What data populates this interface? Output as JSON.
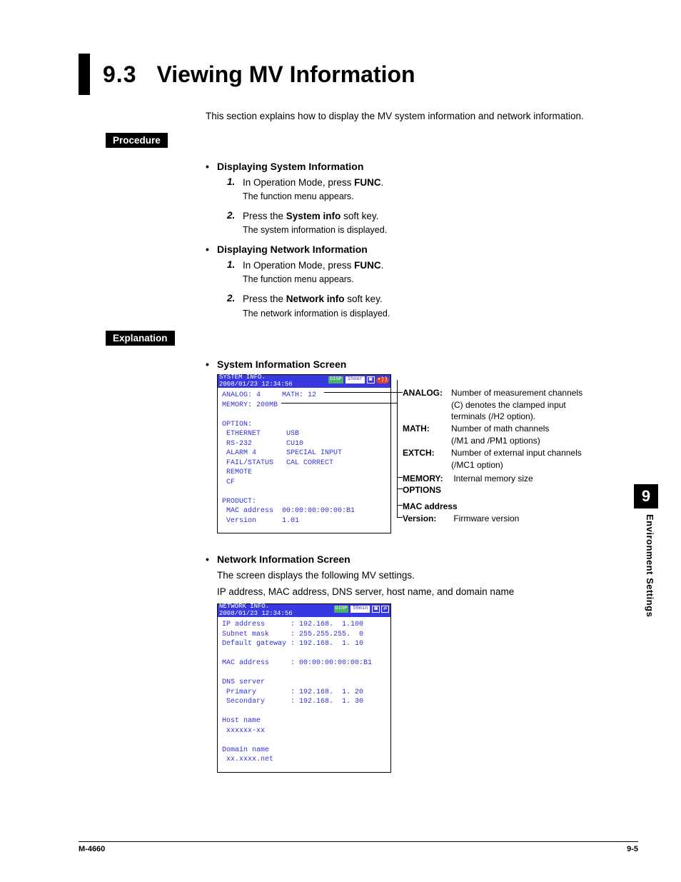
{
  "header": {
    "section_number": "9.3",
    "section_title": "Viewing MV Information",
    "intro": "This section explains how to display the MV system information and network information."
  },
  "labels": {
    "procedure": "Procedure",
    "explanation": "Explanation"
  },
  "procedure": {
    "sys_heading": "Displaying System Information",
    "net_heading": "Displaying Network Information",
    "step1_pre": "In Operation Mode, press ",
    "step1_key": "FUNC",
    "step1_post": ".",
    "step1_note": "The function menu appears.",
    "sys_step2_pre": "Press the ",
    "sys_step2_key": "System info",
    "sys_step2_post": " soft key.",
    "sys_step2_note": "The system information is displayed.",
    "net_step2_pre": "Press the ",
    "net_step2_key": "Network info",
    "net_step2_post": " soft key.",
    "net_step2_note": "The network information is displayed.",
    "num1": "1.",
    "num2": "2."
  },
  "explanation": {
    "sys_screen_heading": "System Information Screen",
    "net_screen_heading": "Network Information Screen",
    "net_line1": "The screen displays the following MV settings.",
    "net_line2": "IP address, MAC address, DNS server, host name, and domain name"
  },
  "sys_screen": {
    "title_l1": "SYSTEM INFO.",
    "title_l2": "2008/01/23 12:34:56",
    "hdr_disp": "DISP",
    "hdr_time": "1hour",
    "body": "ANALOG: 4     MATH: 12\nMEMORY: 200MB\n\nOPTION:\n ETHERNET      USB\n RS-232        CU10\n ALARM 4       SPECIAL INPUT\n FAIL/STATUS   CAL CORRECT\n REMOTE\n CF\n\nPRODUCT:\n MAC address  00:00:00:00:00:B1\n Version      1.01"
  },
  "annotations": {
    "analog_lbl": "ANALOG:",
    "analog_txt1": "Number of measurement channels",
    "analog_txt2": "(C) denotes the clamped input",
    "analog_txt3": "terminals (/H2 option).",
    "math_lbl": "MATH:",
    "math_txt1": "Number of math channels",
    "math_txt2": "(/M1 and /PM1 options)",
    "extch_lbl": "EXTCH:",
    "extch_txt1": "Number of external input channels",
    "extch_txt2": "(/MC1 option)",
    "memory_lbl": "MEMORY:",
    "memory_txt": "Internal memory size",
    "options_lbl": "OPTIONS",
    "mac_lbl": "MAC address",
    "version_lbl": "Version:",
    "version_txt": "Firmware version"
  },
  "net_screen": {
    "title_l1": "NETWORK INFO.",
    "title_l2": "2008/01/23 12:34:56",
    "hdr_disp": "DISP",
    "hdr_time": "59min",
    "body": "IP address      : 192.168.  1.100\nSubnet mask     : 255.255.255.  0\nDefault gateway : 192.168.  1. 10\n\nMAC address     : 00:00:00:00:00:B1\n\nDNS server\n Primary        : 192.168.  1. 20\n Secondary      : 192.168.  1. 30\n\nHost name\n xxxxxx-xx\n\nDomain name\n xx.xxxx.net"
  },
  "sidebar": {
    "chapter_num": "9",
    "chapter_title": "Environment Settings"
  },
  "footer": {
    "left": "M-4660",
    "right": "9-5"
  },
  "bullet": "•"
}
